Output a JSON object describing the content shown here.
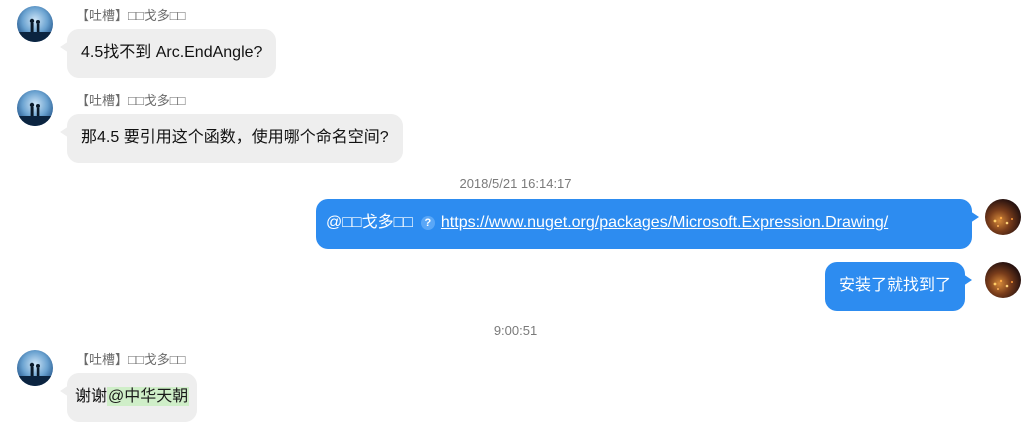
{
  "messages": [
    {
      "sender": "【吐槽】□□戈多□□",
      "text": "4.5找不到 Arc.EndAngle?"
    },
    {
      "sender": "【吐槽】□□戈多□□",
      "text": "那4.5 要引用这个函数，使用哪个命名空间?"
    },
    {
      "timestamp": "2018/5/21 16:14:17"
    },
    {
      "mention": "@□□戈多□□",
      "help_icon": "question-circle-icon",
      "link": "https://www.nuget.org/packages/Microsoft.Expression.Drawing/"
    },
    {
      "text": "安装了就找到了"
    },
    {
      "timestamp": "9:00:51"
    },
    {
      "sender": "【吐槽】□□戈多□□",
      "text_prefix": "谢谢",
      "mention": "@中华天朝"
    }
  ],
  "colors": {
    "outgoing_bubble": "#2d8cf0",
    "incoming_bubble": "#eeeeee",
    "mention_highlight": "#cfeec8"
  }
}
